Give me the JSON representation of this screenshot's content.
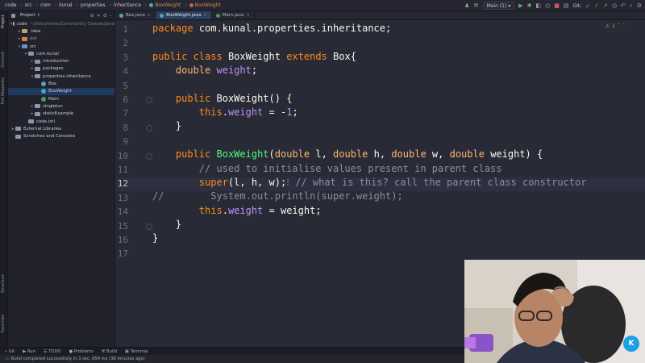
{
  "breadcrumbs": [
    "code",
    "src",
    "com",
    "kunal",
    "properties",
    "inheritance",
    "BoxWeight",
    "BoxWeight"
  ],
  "toolbar": {
    "run_config": "Main (1)",
    "git_label": "Git:"
  },
  "project_panel": {
    "title": "Project",
    "tree": [
      {
        "label": "code",
        "detail": "~/Documents/Community Classes/Java",
        "depth": 0,
        "arrow": "▾",
        "icon": "folder"
      },
      {
        "label": ".idea",
        "depth": 1,
        "arrow": "▸",
        "icon": "folder"
      },
      {
        "label": "out",
        "depth": 1,
        "arrow": "▸",
        "icon": "folder-orange"
      },
      {
        "label": "src",
        "depth": 1,
        "arrow": "▾",
        "icon": "folder-blue"
      },
      {
        "label": "com.kunal",
        "depth": 2,
        "arrow": "▾",
        "icon": "package"
      },
      {
        "label": "introduction",
        "depth": 3,
        "arrow": "▸",
        "icon": "package"
      },
      {
        "label": "packages",
        "depth": 3,
        "arrow": "▸",
        "icon": "package"
      },
      {
        "label": "properties.inheritance",
        "depth": 3,
        "arrow": "▾",
        "icon": "package"
      },
      {
        "label": "Box",
        "depth": 4,
        "arrow": "",
        "icon": "class"
      },
      {
        "label": "BoxWeight",
        "depth": 4,
        "arrow": "",
        "icon": "class",
        "selected": true
      },
      {
        "label": "Main",
        "depth": 4,
        "arrow": "",
        "icon": "class-green"
      },
      {
        "label": "singleton",
        "depth": 3,
        "arrow": "▸",
        "icon": "package"
      },
      {
        "label": "staticExample",
        "depth": 3,
        "arrow": "▸",
        "icon": "package"
      },
      {
        "label": "code.iml",
        "depth": 2,
        "arrow": "",
        "icon": "file"
      },
      {
        "label": "External Libraries",
        "depth": 0,
        "arrow": "▸",
        "icon": "library"
      },
      {
        "label": "Scratches and Consoles",
        "depth": 0,
        "arrow": "",
        "icon": "scratch"
      }
    ]
  },
  "left_strip": [
    "Project",
    "Commit",
    "Pull Requests",
    "Structure",
    "Favorites"
  ],
  "tabs": [
    {
      "label": "Box.java",
      "active": false
    },
    {
      "label": "BoxWeight.java",
      "active": true
    },
    {
      "label": "Main.java",
      "active": false
    }
  ],
  "inspection": "1",
  "editor": {
    "current_line": 12,
    "line_numbers": [
      "1",
      "2",
      "3",
      "4",
      "5",
      "6",
      "7",
      "8",
      "9",
      "10",
      "11",
      "12",
      "13",
      "14",
      "15",
      "16",
      "17"
    ]
  },
  "bottom_tools": [
    "Git",
    "Run",
    "TODO",
    "Problems",
    "Build",
    "Terminal"
  ],
  "status": "Build completed successfully in 3 sec, 654 ms (38 minutes ago)",
  "webcam": {
    "badge": "K"
  }
}
